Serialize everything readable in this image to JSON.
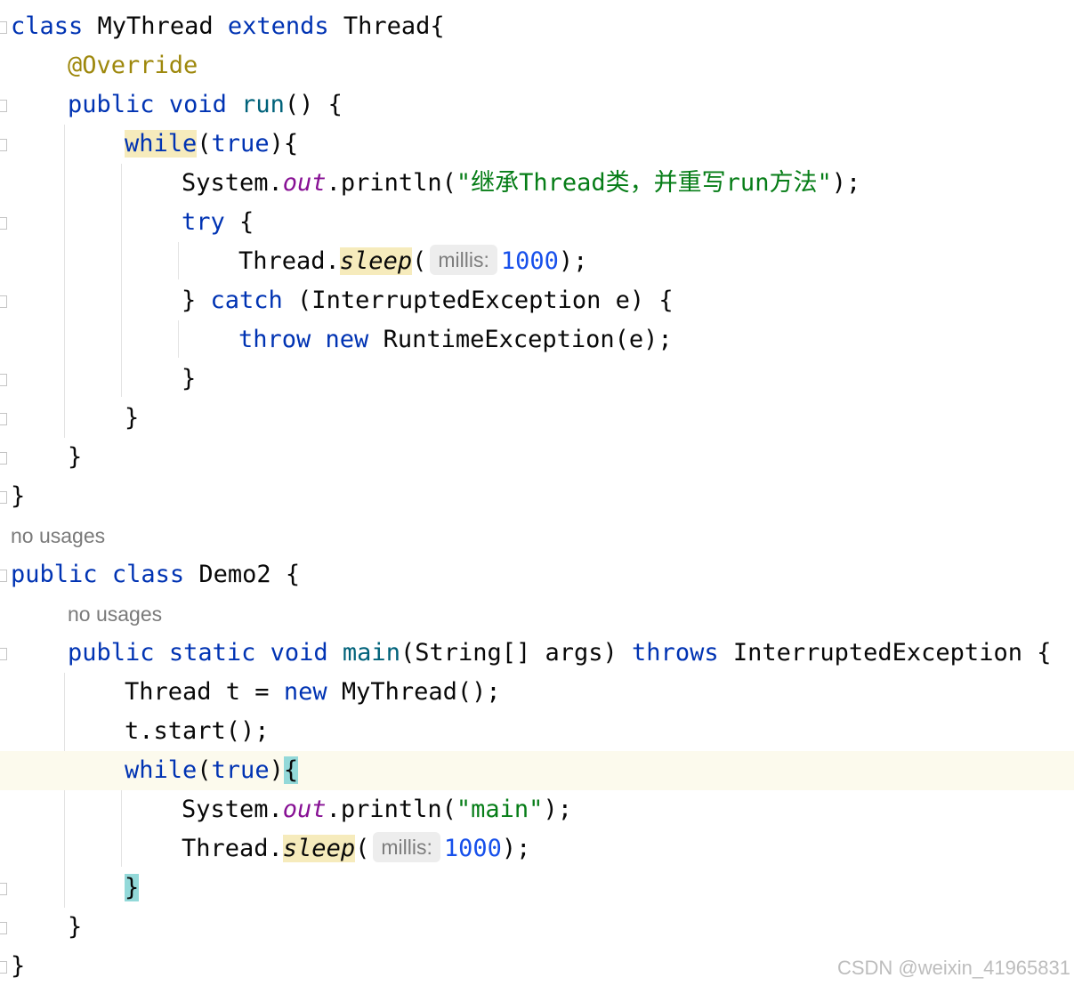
{
  "lines": [
    {
      "id": "l1",
      "tokens": [
        {
          "t": "class",
          "c": "kw"
        },
        {
          "t": " MyThread "
        },
        {
          "t": "extends",
          "c": "kw"
        },
        {
          "t": " Thread{"
        }
      ]
    },
    {
      "id": "l2",
      "tokens": [
        {
          "t": "@Override",
          "c": "ann"
        }
      ]
    },
    {
      "id": "l3",
      "tokens": [
        {
          "t": "public",
          "c": "kw"
        },
        {
          "t": " "
        },
        {
          "t": "void",
          "c": "kw"
        },
        {
          "t": " "
        },
        {
          "t": "run",
          "c": "fn"
        },
        {
          "t": "() {"
        }
      ]
    },
    {
      "id": "l4",
      "tokens": [
        {
          "t": "while",
          "c": "kw hl"
        },
        {
          "t": "("
        },
        {
          "t": "true",
          "c": "kw"
        },
        {
          "t": "){"
        }
      ]
    },
    {
      "id": "l5",
      "tokens": [
        {
          "t": "System."
        },
        {
          "t": "out",
          "c": "field"
        },
        {
          "t": ".println("
        },
        {
          "t": "\"继承Thread类，并重写run方法\"",
          "c": "str"
        },
        {
          "t": ");"
        }
      ]
    },
    {
      "id": "l6",
      "tokens": [
        {
          "t": "try",
          "c": "kw"
        },
        {
          "t": " {"
        }
      ]
    },
    {
      "id": "l7",
      "tokens": [
        {
          "t": "Thread."
        },
        {
          "t": "sleep",
          "c": "static-call hl"
        },
        {
          "t": "("
        },
        {
          "t": "millis:",
          "c": "hint"
        },
        {
          "t": "1000",
          "c": "num"
        },
        {
          "t": ");"
        }
      ]
    },
    {
      "id": "l8",
      "tokens": [
        {
          "t": "} "
        },
        {
          "t": "catch",
          "c": "kw"
        },
        {
          "t": " (InterruptedException e) {"
        }
      ]
    },
    {
      "id": "l9",
      "tokens": [
        {
          "t": "throw",
          "c": "kw"
        },
        {
          "t": " "
        },
        {
          "t": "new",
          "c": "kw"
        },
        {
          "t": " RuntimeException(e);"
        }
      ]
    },
    {
      "id": "l10",
      "tokens": [
        {
          "t": "}"
        }
      ]
    },
    {
      "id": "l11",
      "tokens": [
        {
          "t": "}"
        }
      ]
    },
    {
      "id": "l12",
      "tokens": [
        {
          "t": "}"
        }
      ]
    },
    {
      "id": "l13",
      "tokens": [
        {
          "t": "}"
        }
      ]
    },
    {
      "id": "l14",
      "tokens": [
        {
          "t": "public",
          "c": "kw"
        },
        {
          "t": " "
        },
        {
          "t": "class",
          "c": "kw"
        },
        {
          "t": " Demo2 {"
        }
      ]
    },
    {
      "id": "l15",
      "tokens": [
        {
          "t": "public",
          "c": "kw"
        },
        {
          "t": " "
        },
        {
          "t": "static",
          "c": "kw"
        },
        {
          "t": " "
        },
        {
          "t": "void",
          "c": "kw"
        },
        {
          "t": " "
        },
        {
          "t": "main",
          "c": "fn"
        },
        {
          "t": "(String[] args) "
        },
        {
          "t": "throws",
          "c": "kw"
        },
        {
          "t": " InterruptedException {"
        }
      ]
    },
    {
      "id": "l16",
      "tokens": [
        {
          "t": "Thread t = "
        },
        {
          "t": "new",
          "c": "kw"
        },
        {
          "t": " MyThread();"
        }
      ]
    },
    {
      "id": "l17",
      "tokens": [
        {
          "t": "t.start();"
        }
      ]
    },
    {
      "id": "l18",
      "tokens": [
        {
          "t": "while",
          "c": "kw"
        },
        {
          "t": "("
        },
        {
          "t": "true",
          "c": "kw"
        },
        {
          "t": ")"
        },
        {
          "t": "{",
          "c": "brace-match"
        }
      ]
    },
    {
      "id": "l19",
      "tokens": [
        {
          "t": "System."
        },
        {
          "t": "out",
          "c": "field"
        },
        {
          "t": ".println("
        },
        {
          "t": "\"main\"",
          "c": "str"
        },
        {
          "t": ");"
        }
      ]
    },
    {
      "id": "l20",
      "tokens": [
        {
          "t": "Thread."
        },
        {
          "t": "sleep",
          "c": "static-call hl"
        },
        {
          "t": "("
        },
        {
          "t": "millis:",
          "c": "hint"
        },
        {
          "t": "1000",
          "c": "num"
        },
        {
          "t": ");"
        }
      ]
    },
    {
      "id": "l21",
      "tokens": [
        {
          "t": "}",
          "c": "brace-match"
        }
      ]
    },
    {
      "id": "l22",
      "tokens": [
        {
          "t": "}"
        }
      ]
    },
    {
      "id": "l23",
      "tokens": [
        {
          "t": "}"
        }
      ]
    }
  ],
  "code_lens": {
    "class_usages": "no usages",
    "method_usages": "no usages"
  },
  "watermark": "CSDN @weixin_41965831"
}
